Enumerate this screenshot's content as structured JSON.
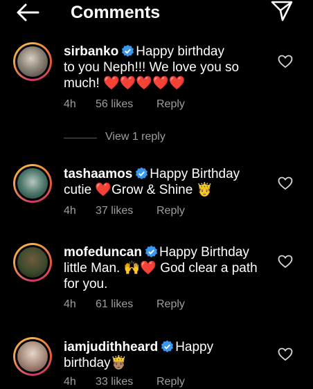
{
  "header": {
    "title": "Comments",
    "back_icon": "arrow-left-icon",
    "share_icon": "paper-plane-icon"
  },
  "comments": [
    {
      "username": "sirbanko",
      "verified": true,
      "text_line1": "Happy birthday",
      "text_line2": "to you Neph!!! We love you so",
      "text_line3": "much!",
      "emoji_trail": "❤️❤️❤️❤️❤️",
      "time": "4h",
      "likes": "56 likes",
      "reply_label": "Reply",
      "view_replies": "View 1 reply"
    },
    {
      "username": "tashaamos",
      "verified": true,
      "text_line1": "Happy Birthday",
      "text_line2a": "cutie",
      "emoji_heart": "❤️",
      "text_line2b": "Grow & Shine",
      "emoji_prince": "🤴",
      "time": "4h",
      "likes": "37 likes",
      "reply_label": "Reply"
    },
    {
      "username": "mofeduncan",
      "verified": true,
      "text_line1": "Happy Birthday",
      "text_line2a": "little Man.",
      "emoji_hands_heart": "🙌❤️",
      "text_line2b": "God clear a path",
      "text_line3": "for you.",
      "time": "4h",
      "likes": "61 likes",
      "reply_label": "Reply"
    },
    {
      "username": "iamjudithheard",
      "verified": true,
      "text_line1": "Happy",
      "text_line2": "birthday",
      "emoji_prince": "🤴🏽",
      "time": "4h",
      "likes": "33 likes",
      "reply_label": "Reply"
    }
  ],
  "colors": {
    "background": "#000000",
    "text": "#ffffff",
    "meta": "#9e9e9e",
    "verified": "#3897f0",
    "heart": "#e0242c"
  }
}
